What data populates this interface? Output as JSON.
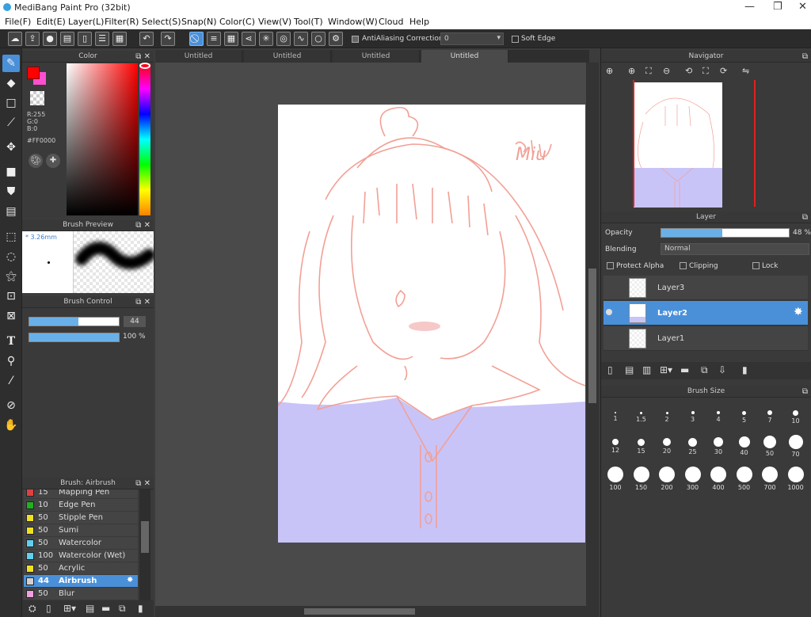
{
  "app": {
    "title": "MediBang Paint Pro (32bit)"
  },
  "menu": [
    "File(F)",
    "Edit(E)",
    "Layer(L)",
    "Filter(R)",
    "Select(S)",
    "Snap(N)",
    "Color(C)",
    "View(V)",
    "Tool(T)",
    "Window(W)",
    "Cloud",
    "Help"
  ],
  "toolbar": {
    "antialias_label": "AntiAliasing",
    "correction_label": "Correction",
    "correction_value": "0",
    "soft_edge_label": "Soft Edge"
  },
  "color_panel": {
    "title": "Color",
    "r": "R:255",
    "g": "G:0",
    "b": "B:0",
    "hex": "#FF0000",
    "fg": "#ff0000",
    "bg": "#ff4fd0"
  },
  "brush_preview": {
    "title": "Brush Preview",
    "size": "* 3.26mm"
  },
  "brush_control": {
    "title": "Brush Control",
    "size_value": "44",
    "size_fraction": 0.55,
    "opacity_value": "100 %",
    "opacity_fraction": 1.0
  },
  "brush_list": {
    "title": "Brush: Airbrush",
    "items": [
      {
        "n": "15",
        "name": "Mapping Pen",
        "color": "#e04040"
      },
      {
        "n": "10",
        "name": "Edge Pen",
        "color": "#20b020"
      },
      {
        "n": "50",
        "name": "Stipple Pen",
        "color": "#f0e020"
      },
      {
        "n": "50",
        "name": "Sumi",
        "color": "#f0e020"
      },
      {
        "n": "50",
        "name": "Watercolor",
        "color": "#60d0f0"
      },
      {
        "n": "100",
        "name": "Watercolor (Wet)",
        "color": "#60d0f0"
      },
      {
        "n": "50",
        "name": "Acrylic",
        "color": "#f0e020"
      },
      {
        "n": "44",
        "name": "Airbrush",
        "color": "#d0d0d0"
      },
      {
        "n": "50",
        "name": "Blur",
        "color": "#f0a0e0"
      }
    ]
  },
  "tabs": [
    "Untitled",
    "Untitled",
    "Untitled",
    "Untitled"
  ],
  "navigator": {
    "title": "Navigator"
  },
  "layer_panel": {
    "title": "Layer",
    "opacity_label": "Opacity",
    "opacity_value": "48 %",
    "opacity_fraction": 0.48,
    "blending_label": "Blending",
    "blending_value": "Normal",
    "protect_alpha": "Protect Alpha",
    "clipping": "Clipping",
    "lock": "Lock",
    "layers": [
      {
        "name": "Layer3"
      },
      {
        "name": "Layer2"
      },
      {
        "name": "Layer1"
      }
    ]
  },
  "brush_size": {
    "title": "Brush Size",
    "sizes": [
      "1",
      "1.5",
      "2",
      "3",
      "4",
      "5",
      "7",
      "10",
      "12",
      "15",
      "20",
      "25",
      "30",
      "40",
      "50",
      "70",
      "100",
      "150",
      "200",
      "300",
      "400",
      "500",
      "700",
      "1000"
    ]
  },
  "canvas": {
    "signature": "Miu"
  }
}
